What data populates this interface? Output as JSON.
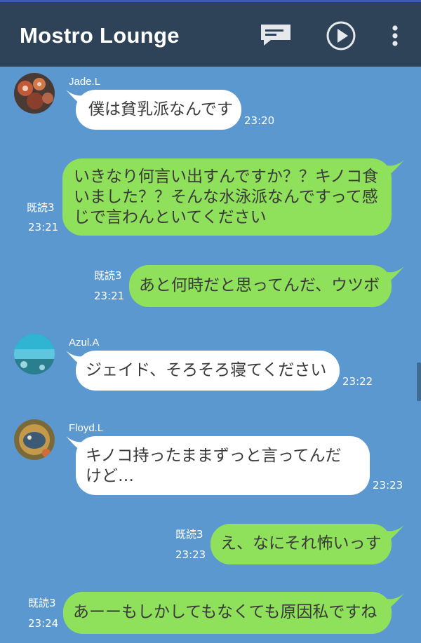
{
  "header": {
    "title": "Mostro Lounge",
    "icons": [
      "message-icon",
      "play-icon",
      "more-vertical-icon"
    ]
  },
  "colors": {
    "background": "#5b98cf",
    "header": "#2e4357",
    "incoming_bubble": "#ffffff",
    "outgoing_bubble": "#8fe05b"
  },
  "messages": [
    {
      "sender": "Jade.L",
      "text": "僕は貧乳派なんです",
      "time": "23:20"
    },
    {
      "read": "既読3",
      "text": "いきなり何言い出すんですか？？キノコ食\nいました？？そんな水泳派なんですって感\nじで言わんといてください",
      "time": "23:21"
    },
    {
      "read": "既読3",
      "text": "あと何時だと思ってんだ、ウツボ",
      "time": "23:21"
    },
    {
      "sender": "Azul.A",
      "text": "ジェイド、そろそろ寝てください",
      "time": "23:22"
    },
    {
      "sender": "Floyd.L",
      "text": "キノコ持ったままずっと言ってんだ\nけど…",
      "time": "23:23"
    },
    {
      "read": "既読3",
      "text": "え、なにそれ怖いっす",
      "time": "23:23"
    },
    {
      "read": "既読3",
      "text": "あーーもしかしてもなくても原因私ですね",
      "time": "23:24"
    }
  ]
}
